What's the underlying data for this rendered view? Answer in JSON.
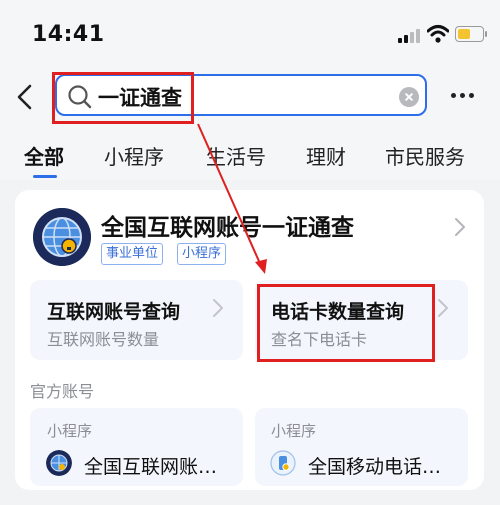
{
  "status_bar": {
    "time": "14:41"
  },
  "search": {
    "query": "一证通查"
  },
  "tabs": [
    {
      "label": "全部",
      "active": true
    },
    {
      "label": "小程序"
    },
    {
      "label": "生活号"
    },
    {
      "label": "理财"
    },
    {
      "label": "市民服务"
    }
  ],
  "result": {
    "title": "全国互联网账号一证通查",
    "tags": [
      "事业单位",
      "小程序"
    ],
    "services": [
      {
        "title": "互联网账号查询",
        "subtitle": "互联网账号数量"
      },
      {
        "title": "电话卡数量查询",
        "subtitle": "查名下电话卡"
      }
    ],
    "official_accounts_label": "官方账号",
    "accounts": [
      {
        "type": "小程序",
        "name": "全国互联网账…"
      },
      {
        "type": "小程序",
        "name": "全国移动电话…"
      }
    ]
  },
  "colors": {
    "accent": "#2f6ee9",
    "annotation": "#e02020",
    "battery": "#f4c430"
  }
}
